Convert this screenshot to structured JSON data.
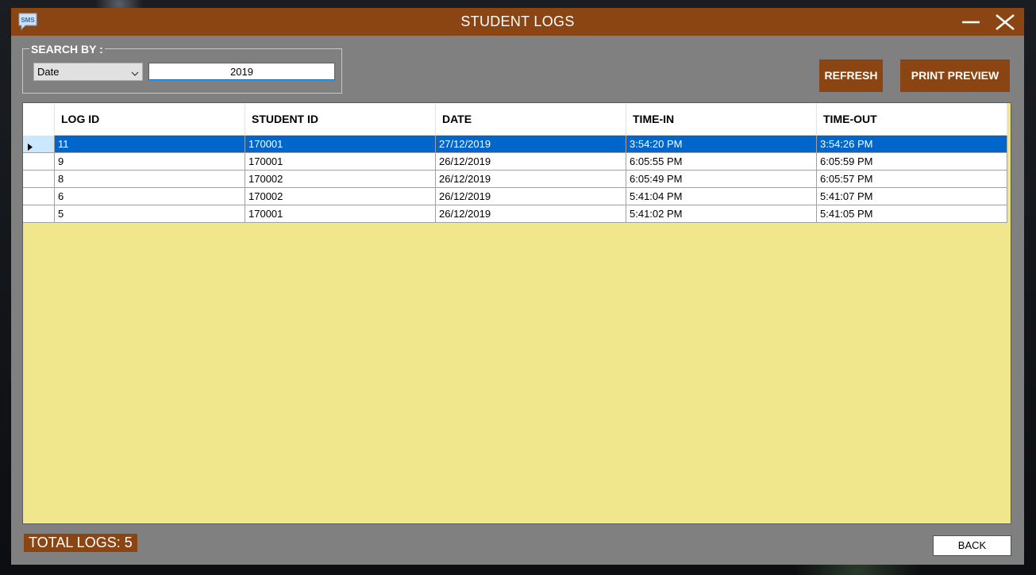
{
  "window": {
    "title": "STUDENT LOGS",
    "app_icon_text": "SMS",
    "accent_color": "#8B4513"
  },
  "search": {
    "legend": "SEARCH BY :",
    "field_selected": "Date",
    "query": "2019"
  },
  "toolbar": {
    "refresh_label": "REFRESH",
    "print_preview_label": "PRINT PREVIEW"
  },
  "table": {
    "columns": [
      "LOG ID",
      "STUDENT ID",
      "DATE",
      "TIME-IN",
      "TIME-OUT"
    ],
    "rows": [
      {
        "log_id": "11",
        "student_id": "170001",
        "date": "27/12/2019",
        "time_in": "3:54:20 PM",
        "time_out": "3:54:26 PM",
        "selected": true
      },
      {
        "log_id": "9",
        "student_id": "170001",
        "date": "26/12/2019",
        "time_in": "6:05:55 PM",
        "time_out": "6:05:59 PM",
        "selected": false
      },
      {
        "log_id": "8",
        "student_id": "170002",
        "date": "26/12/2019",
        "time_in": "6:05:49 PM",
        "time_out": "6:05:57 PM",
        "selected": false
      },
      {
        "log_id": "6",
        "student_id": "170002",
        "date": "26/12/2019",
        "time_in": "5:41:04 PM",
        "time_out": "5:41:07 PM",
        "selected": false
      },
      {
        "log_id": "5",
        "student_id": "170001",
        "date": "26/12/2019",
        "time_in": "5:41:02 PM",
        "time_out": "5:41:05 PM",
        "selected": false
      }
    ],
    "empty_area_color": "#F0E68C",
    "selected_row_color": "#0066CC"
  },
  "footer": {
    "total_logs_label": "TOTAL LOGS: 5",
    "back_label": "BACK"
  }
}
